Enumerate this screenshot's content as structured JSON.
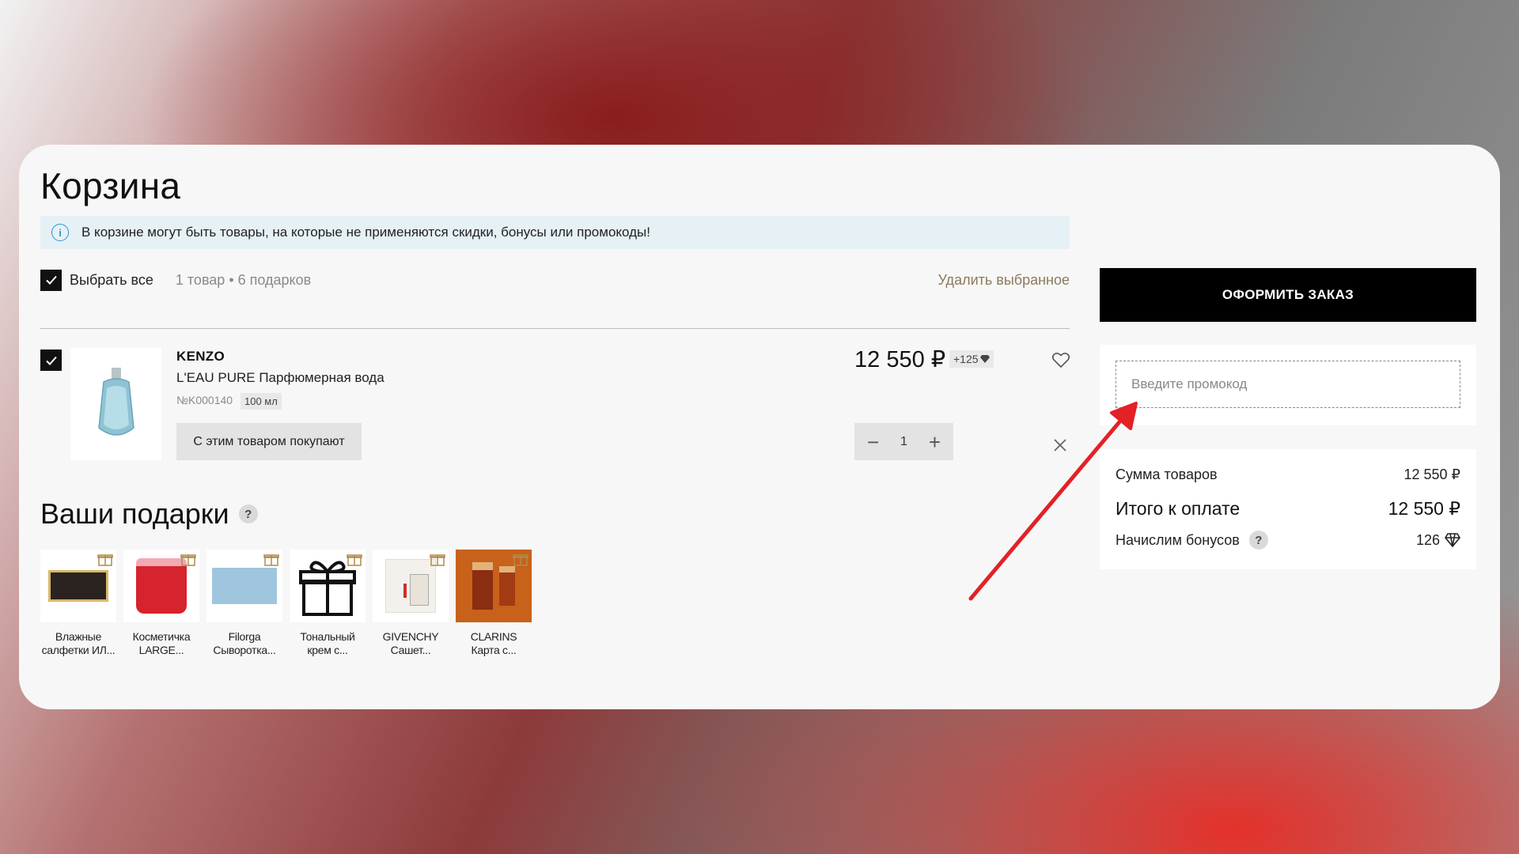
{
  "page": {
    "title": "Корзина",
    "notice": "В корзине могут быть товары, на которые не применяются скидки, бонусы или промокоды!"
  },
  "cart": {
    "select_all_label": "Выбрать все",
    "count_text": "1 товар • 6 подарков",
    "delete_selected_label": "Удалить выбранное",
    "item": {
      "brand": "KENZO",
      "name": "L'EAU PURE Парфюмерная вода",
      "sku": "№K000140",
      "volume": "100 мл",
      "also_buy_label": "С этим товаром покупают",
      "price": "12 550 ₽",
      "bonus": "+125",
      "quantity": "1",
      "selected": true
    }
  },
  "gifts": {
    "title": "Ваши подарки",
    "items": [
      {
        "line1": "Влажные",
        "line2": "салфетки ИЛ...",
        "color": "#2a2320"
      },
      {
        "line1": "Косметичка",
        "line2": "LARGE...",
        "color": "#d6232e"
      },
      {
        "line1": "Filorga",
        "line2": "Сыворотка...",
        "color": "#9fc6de"
      },
      {
        "line1": "Тональный",
        "line2": "крем с...",
        "color": "#111111"
      },
      {
        "line1": "GIVENCHY",
        "line2": "Сашет...",
        "color": "#e8e2d9"
      },
      {
        "line1": "CLARINS",
        "line2": "Карта с...",
        "color": "#c8611a"
      }
    ]
  },
  "sidebar": {
    "order_button": "ОФОРМИТЬ ЗАКАЗ",
    "promo_placeholder": "Введите промокод",
    "summary": {
      "goods_label": "Сумма товаров",
      "goods_value": "12 550 ₽",
      "total_label": "Итого к оплате",
      "total_value": "12 550 ₽",
      "bonus_label": "Начислим бонусов",
      "bonus_value": "126"
    }
  },
  "colors": {
    "accent_gold": "#8a7b5a",
    "annotation_arrow": "#e32126",
    "notice_bg": "#e6f1f6"
  }
}
